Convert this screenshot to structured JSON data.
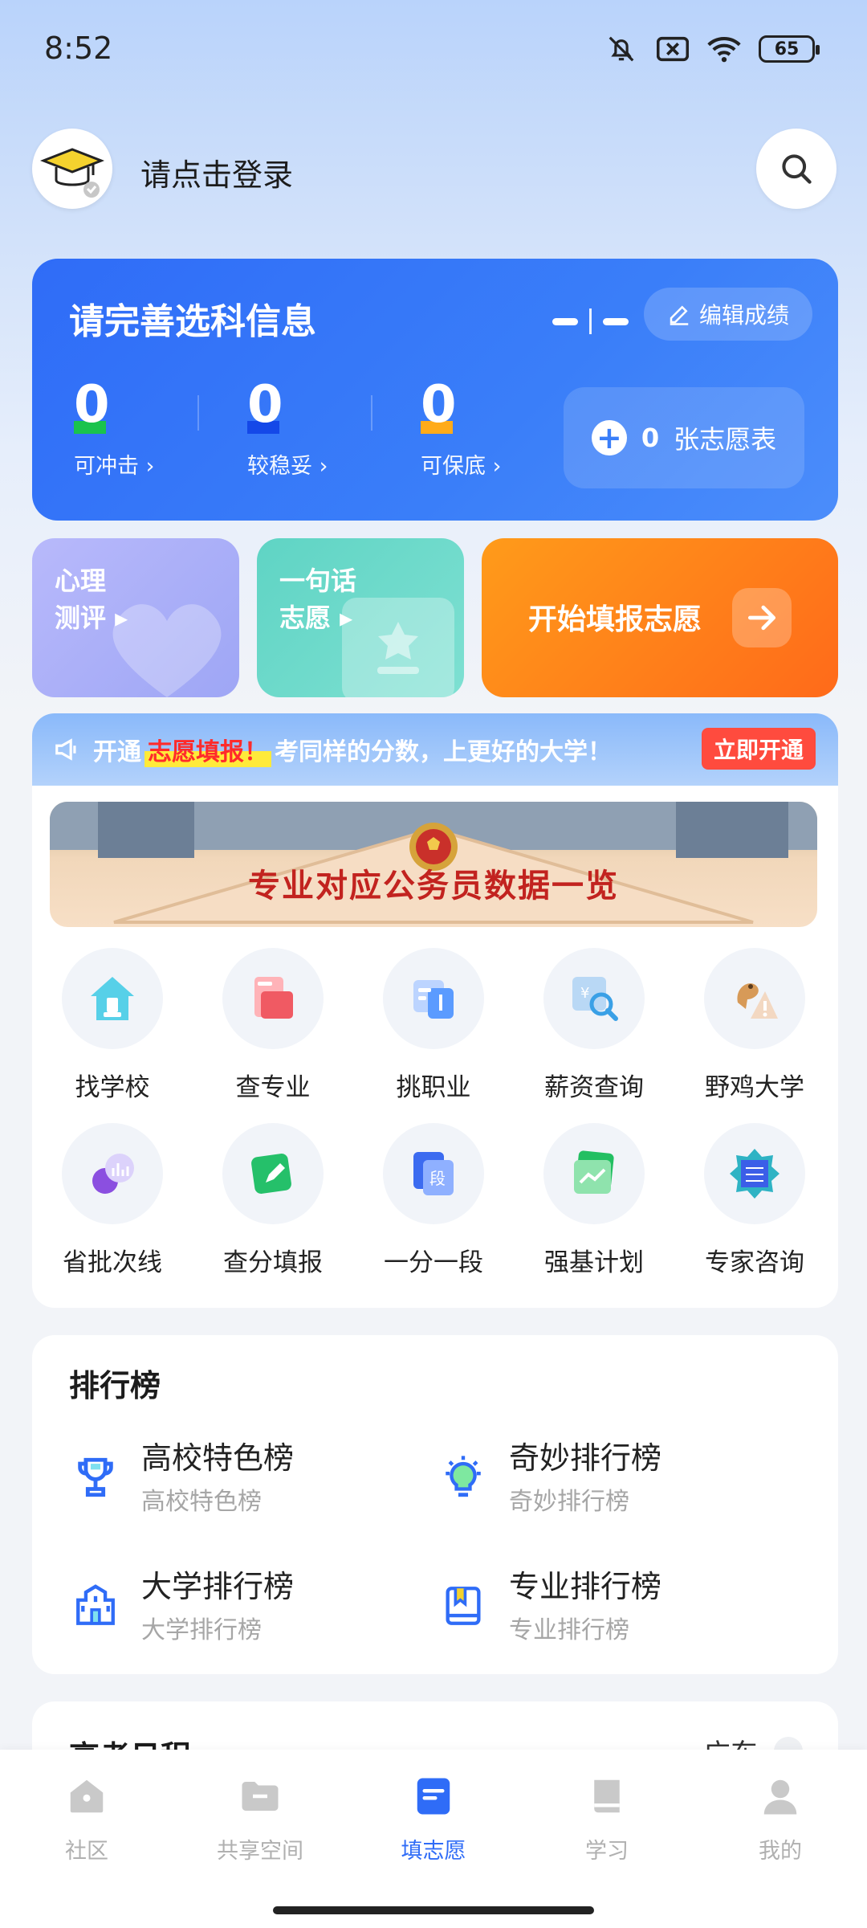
{
  "status_bar": {
    "time": "8:52",
    "battery": "65",
    "icons": [
      "bell-off-icon",
      "close-box-icon",
      "wifi-icon",
      "battery-icon"
    ]
  },
  "header": {
    "login_text": "请点击登录",
    "search_icon": "search-icon"
  },
  "score_card": {
    "title": "请完善选科信息",
    "edit_label": "编辑成绩",
    "stats": [
      {
        "value": "0",
        "label": "可冲击 ›",
        "color": "#1ac34d"
      },
      {
        "value": "0",
        "label": "较稳妥 ›",
        "color": "#1448e8"
      },
      {
        "value": "0",
        "label": "可保底 ›",
        "color": "#ffab1a"
      }
    ],
    "wish_count": "0",
    "wish_label": "张志愿表"
  },
  "tiles": {
    "psy_line1": "心理",
    "psy_line2": "测评 ▸",
    "one_line1": "一句话",
    "one_line2": "志愿 ▸",
    "start_label": "开始填报志愿"
  },
  "promo": {
    "prefix": "开通",
    "highlight": "志愿填报！",
    "suffix": "考同样的分数，上更好的大学！",
    "button": "立即开通"
  },
  "banner": {
    "text": "专业对应公务员数据一览"
  },
  "features": [
    {
      "label": "找学校",
      "icon": "school-icon"
    },
    {
      "label": "查专业",
      "icon": "book-icon"
    },
    {
      "label": "挑职业",
      "icon": "career-icon"
    },
    {
      "label": "薪资查询",
      "icon": "salary-search-icon"
    },
    {
      "label": "野鸡大学",
      "icon": "warning-bird-icon"
    },
    {
      "label": "省批次线",
      "icon": "chart-icon"
    },
    {
      "label": "查分填报",
      "icon": "edit-icon"
    },
    {
      "label": "一分一段",
      "icon": "segment-icon"
    },
    {
      "label": "强基计划",
      "icon": "trend-icon"
    },
    {
      "label": "专家咨询",
      "icon": "expert-icon"
    }
  ],
  "rankings": {
    "title": "排行榜",
    "items": [
      {
        "name": "高校特色榜",
        "sub": "高校特色榜",
        "icon": "trophy-icon"
      },
      {
        "name": "奇妙排行榜",
        "sub": "奇妙排行榜",
        "icon": "lightbulb-icon"
      },
      {
        "name": "大学排行榜",
        "sub": "大学排行榜",
        "icon": "university-icon"
      },
      {
        "name": "专业排行榜",
        "sub": "专业排行榜",
        "icon": "major-book-icon"
      }
    ]
  },
  "schedule": {
    "title": "高考日程",
    "region": "广东"
  },
  "bottom_nav": [
    {
      "label": "社区",
      "icon": "community-icon"
    },
    {
      "label": "共享空间",
      "icon": "folder-icon"
    },
    {
      "label": "填志愿",
      "icon": "form-icon"
    },
    {
      "label": "学习",
      "icon": "study-book-icon"
    },
    {
      "label": "我的",
      "icon": "person-icon"
    }
  ],
  "colors": {
    "primary": "#2f6cf7",
    "orange": "#ff7a1a",
    "promo_red": "#ff4b3e"
  }
}
